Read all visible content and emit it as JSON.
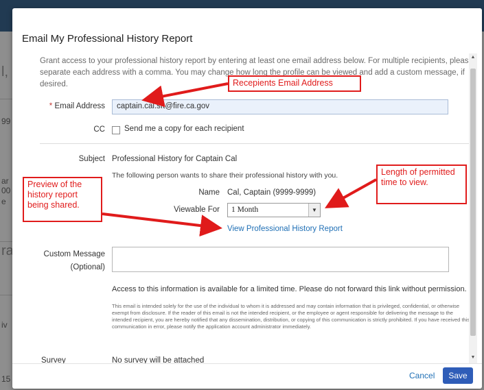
{
  "background": {
    "left_fragments": [
      "l,",
      "99",
      "ar",
      "00",
      "e",
      "ra",
      "iv",
      "15"
    ]
  },
  "modal": {
    "title": "Email My Professional History Report",
    "intro": "Grant access to your professional history report by entering at least one email address below. For multiple recipients, please separate each address with a comma. You may change how long the profile can be viewed and add a custom message, if desired.",
    "email": {
      "required_marker": "*",
      "label": "Email Address",
      "value": "captain.cal.sft@fire.ca.gov"
    },
    "cc": {
      "label": "CC",
      "checkbox_text": "Send me a copy for each recipient",
      "checked": false
    },
    "subject": {
      "label": "Subject",
      "value": "Professional History for Captain Cal"
    },
    "share_text": "The following person wants to share their professional history with you.",
    "name": {
      "label": "Name",
      "value": "Cal, Captain (9999-9999)"
    },
    "viewable_for": {
      "label": "Viewable For",
      "selected": "1 Month"
    },
    "view_link": "View Professional History Report",
    "custom_message": {
      "label": "Custom Message",
      "sublabel": "(Optional)",
      "value": ""
    },
    "notice": "Access to this information is available for a limited time. Please do not forward this link without permission.",
    "disclaimer": "This email is intended solely for the use of the individual to whom it is addressed and may contain information that is privileged, confidential, or otherwise exempt from disclosure. If the reader of this email is not the intended recipient, or the employee or agent responsible for delivering the message to the intended recipient, you are hereby notified that any dissemination, distribution, or copying of this communication is strictly prohibited. If you have received this communication in error, please notify the application account administrator immediately.",
    "survey": {
      "label": "Survey",
      "value": "No survey will be attached"
    },
    "cancel_label": "Cancel",
    "save_label": "Save"
  },
  "annotations": {
    "recipients": "Recepients Email Address",
    "length": "Length of permitted time to view.",
    "preview": "Preview of the history report being shared."
  },
  "colors": {
    "accent": "#2f5db8",
    "link": "#1f6fb5",
    "annotation": "#e01b1b",
    "required": "#c23934"
  }
}
